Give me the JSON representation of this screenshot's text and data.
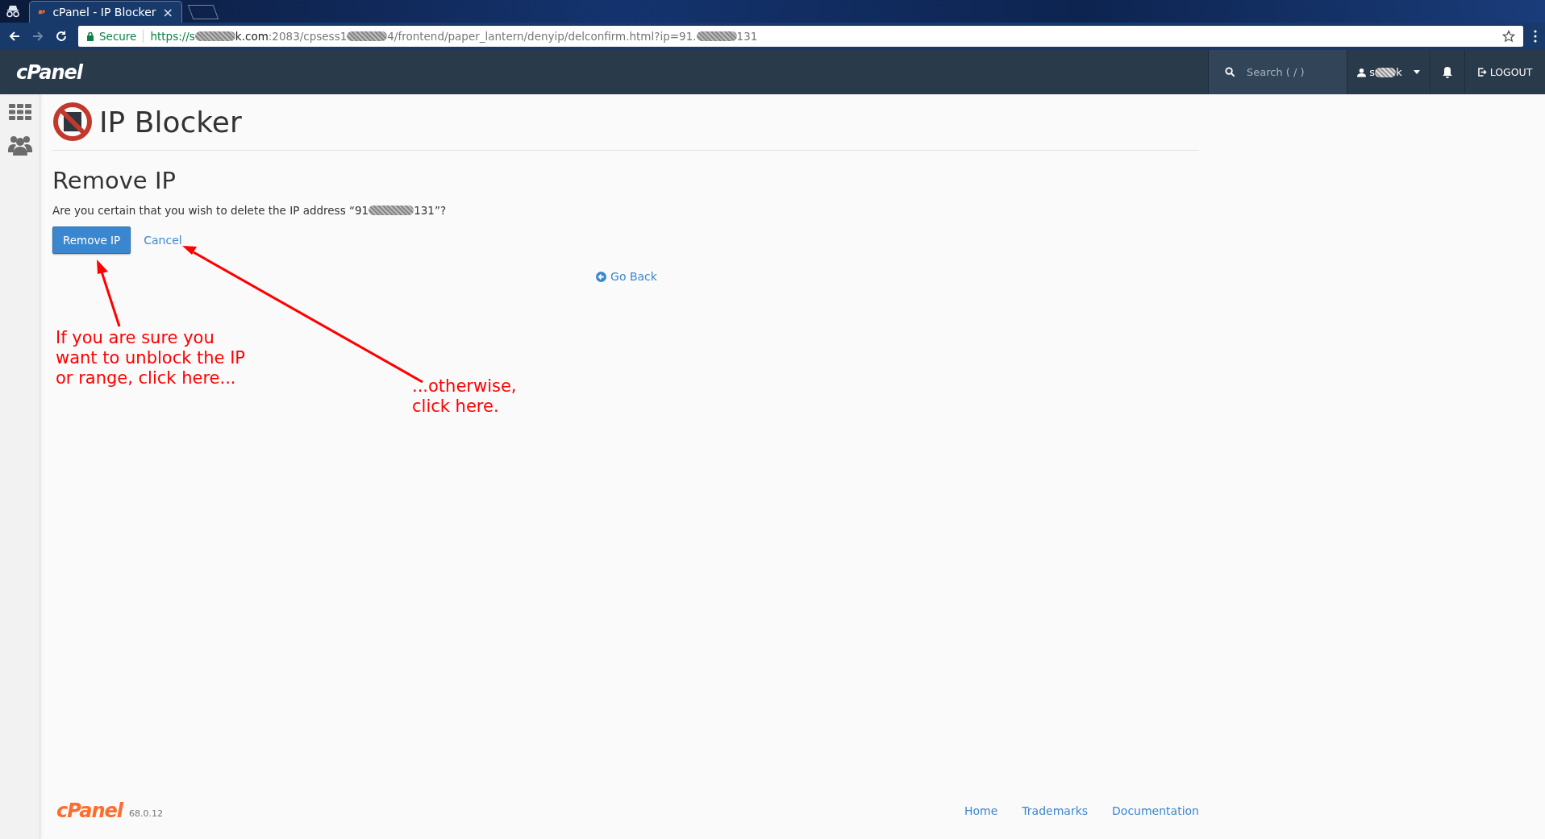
{
  "browser": {
    "tab": {
      "title": "cPanel - IP Blocker",
      "close": "×"
    },
    "address": {
      "secure": "Secure",
      "url": [
        {
          "kind": "scheme",
          "text": "https://s"
        },
        {
          "kind": "redacted"
        },
        {
          "kind": "host",
          "text": "k.com"
        },
        {
          "kind": "path",
          "text": ":2083/cpsess1"
        },
        {
          "kind": "redacted"
        },
        {
          "kind": "path",
          "text": "4/frontend/paper_lantern/denyip/delconfirm.html?ip=91."
        },
        {
          "kind": "redacted"
        },
        {
          "kind": "path",
          "text": "131"
        }
      ]
    }
  },
  "header": {
    "logo": "cPanel",
    "search": {
      "placeholder": "Search ( / )"
    },
    "user": [
      {
        "kind": "text",
        "text": "s"
      },
      {
        "kind": "redacted"
      },
      {
        "kind": "text",
        "text": "k"
      }
    ],
    "logout": "LOGOUT"
  },
  "page": {
    "title": "IP Blocker",
    "heading": "Remove IP",
    "question": [
      {
        "kind": "text",
        "text": "Are you certain that you wish to delete the IP address “91"
      },
      {
        "kind": "redacted"
      },
      {
        "kind": "text",
        "text": "131”?"
      }
    ],
    "remove_button": "Remove IP",
    "cancel": "Cancel",
    "go_back": "Go Back"
  },
  "annotations": [
    {
      "text": "If you are sure you\nwant to unblock the IP\nor range, click here..."
    },
    {
      "text": "...otherwise,\nclick here."
    }
  ],
  "footer": {
    "logo": "cPanel",
    "version": "68.0.12",
    "links": [
      "Home",
      "Trademarks",
      "Documentation"
    ]
  }
}
